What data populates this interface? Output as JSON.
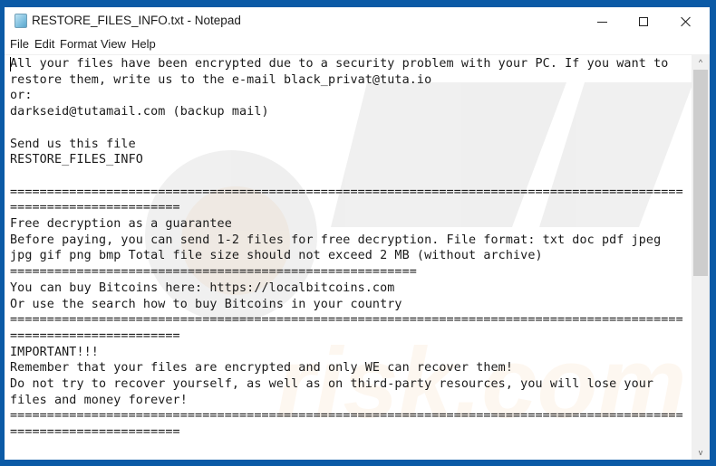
{
  "window": {
    "title": "RESTORE_FILES_INFO.txt - Notepad",
    "app_icon": "notepad-icon",
    "controls": {
      "minimize": "minimize-icon",
      "maximize": "maximize-icon",
      "close": "close-icon"
    }
  },
  "menubar": {
    "items": [
      {
        "label": "File"
      },
      {
        "label": "Edit"
      },
      {
        "label": "Format"
      },
      {
        "label": "View"
      },
      {
        "label": "Help"
      }
    ]
  },
  "editor": {
    "lines": [
      "All your files have been encrypted due to a security problem with your PC. If you want to",
      "restore them, write us to the e-mail black_privat@tuta.io",
      "or:",
      "darkseid@tutamail.com (backup mail)",
      "",
      "Send us this file",
      "RESTORE_FILES_INFO",
      "",
      "===========================================================================================",
      "=======================",
      "Free decryption as a guarantee",
      "Before paying, you can send 1-2 files for free decryption. File format: txt doc pdf jpeg",
      "jpg gif png bmp Total file size should not exceed 2 MB (without archive)",
      "=======================================================",
      "You can buy Bitcoins here: https://localbitcoins.com",
      "Or use the search how to buy Bitcoins in your country",
      "===========================================================================================",
      "=======================",
      "IMPORTANT!!!",
      "Remember that your files are encrypted and only WE can recover them!",
      "Do not try to recover yourself, as well as on third-party resources, you will lose your",
      "files and money forever!",
      "===========================================================================================",
      "======================="
    ]
  },
  "scrollbar": {
    "up_arrow": "^",
    "down_arrow": "v",
    "position_fraction": 0.0,
    "visible_fraction": 0.55
  },
  "colors": {
    "desktop_border": "#0b5aa6",
    "scroll_thumb": "#cdcdcd",
    "scroll_track": "#f0f0f0",
    "text": "#1a1a1a"
  }
}
